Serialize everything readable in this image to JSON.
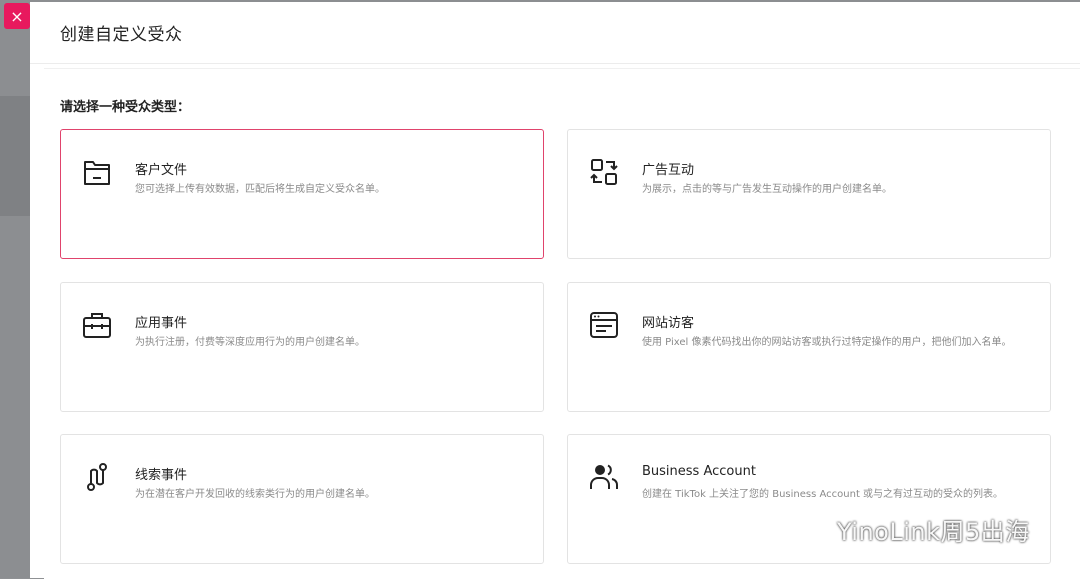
{
  "modal": {
    "close_icon": "×",
    "title": "创建自定义受众",
    "prompt": "请选择一种受众类型："
  },
  "cards": [
    {
      "icon": "folder-icon",
      "title": "客户文件",
      "desc": "您可选择上传有效数据，匹配后将生成自定义受众名单。",
      "selected": true
    },
    {
      "icon": "ad-interaction-icon",
      "title": "广告互动",
      "desc": "为展示，点击的等与广告发生互动操作的用户创建名单。",
      "selected": false
    },
    {
      "icon": "briefcase-icon",
      "title": "应用事件",
      "desc": "为执行注册，付费等深度应用行为的用户创建名单。",
      "selected": false
    },
    {
      "icon": "browser-window-icon",
      "title": "网站访客",
      "desc": "使用 Pixel 像素代码找出你的网站访客或执行过特定操作的用户，把他们加入名单。",
      "selected": false
    },
    {
      "icon": "lead-path-icon",
      "title": "线索事件",
      "desc": "为在潜在客户开发回收的线索类行为的用户创建名单。",
      "selected": false
    },
    {
      "icon": "users-icon",
      "title": "Business Account",
      "desc": "创建在 TikTok 上关注了您的 Business Account 或与之有过互动的受众的列表。",
      "selected": false
    }
  ],
  "watermark": {
    "text": "YinoLink周5出海"
  },
  "colors": {
    "accent": "#e8195e",
    "selected_border": "#e0436c"
  }
}
